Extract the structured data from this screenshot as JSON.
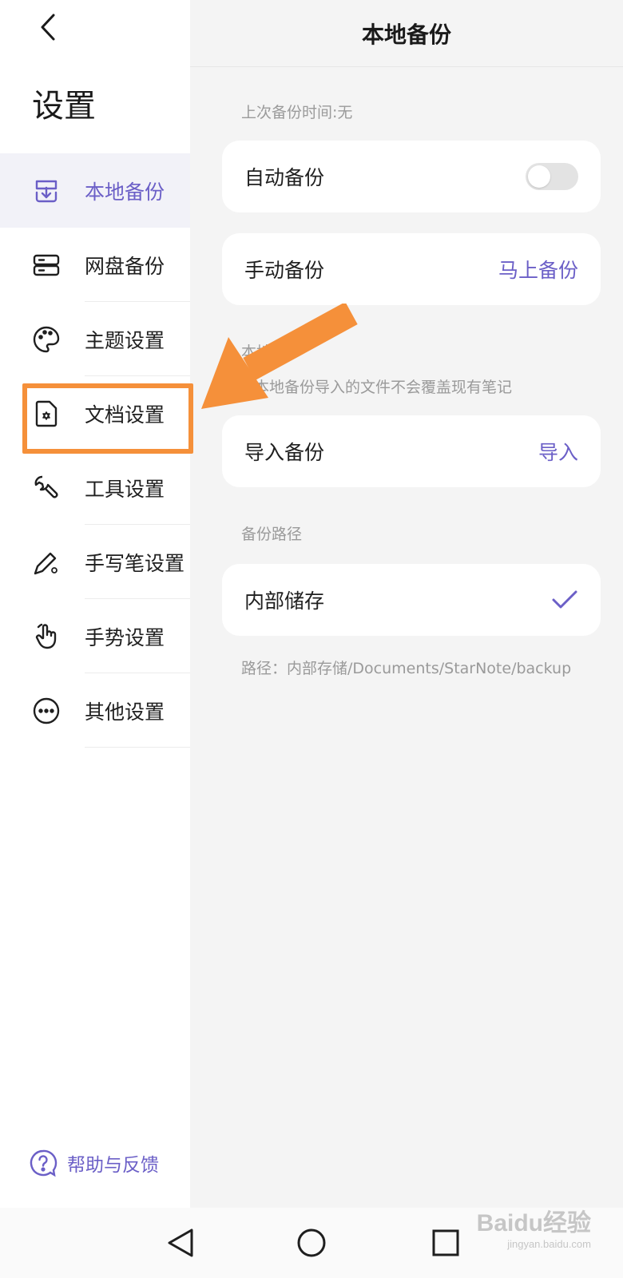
{
  "sidebar": {
    "title": "设置",
    "items": [
      {
        "label": "本地备份",
        "icon": "local-backup-icon"
      },
      {
        "label": "网盘备份",
        "icon": "cloud-backup-icon"
      },
      {
        "label": "主题设置",
        "icon": "palette-icon"
      },
      {
        "label": "文档设置",
        "icon": "document-settings-icon"
      },
      {
        "label": "工具设置",
        "icon": "wrench-icon"
      },
      {
        "label": "手写笔设置",
        "icon": "pen-settings-icon"
      },
      {
        "label": "手势设置",
        "icon": "gesture-icon"
      },
      {
        "label": "其他设置",
        "icon": "more-icon"
      }
    ],
    "active_index": 0,
    "help_label": "帮助与反馈"
  },
  "main": {
    "title": "本地备份",
    "last_backup": "上次备份时间:无",
    "auto_backup": {
      "label": "自动备份",
      "enabled": false
    },
    "manual_backup": {
      "label": "手动备份",
      "action": "马上备份"
    },
    "import_section": {
      "title": "本地恢",
      "note": "本地备份导入的文件不会覆盖现有笔记"
    },
    "import_backup": {
      "label": "导入备份",
      "action": "导入"
    },
    "path_section": {
      "title": "备份路径"
    },
    "internal_storage": {
      "label": "内部储存",
      "selected": true
    },
    "path": "路径：内部存储/Documents/StarNote/backup"
  },
  "watermark": {
    "main": "Baidu经验",
    "sub": "jingyan.baidu.com"
  },
  "colors": {
    "accent": "#6b5fc7",
    "highlight": "#f5903a",
    "panel_bg": "#f4f4f4",
    "active_item_bg": "#f2f2f8"
  }
}
